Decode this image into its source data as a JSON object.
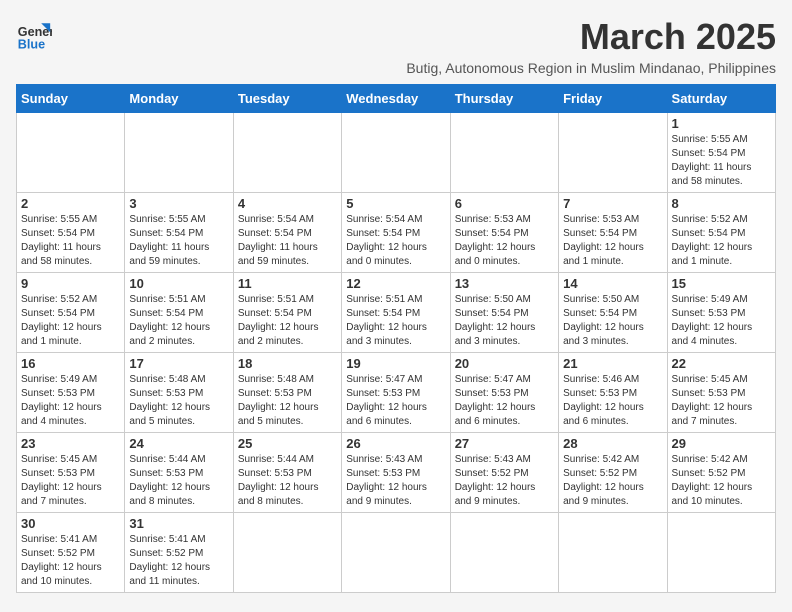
{
  "logo": {
    "text_general": "General",
    "text_blue": "Blue"
  },
  "header": {
    "month_year": "March 2025",
    "location": "Butig, Autonomous Region in Muslim Mindanao, Philippines"
  },
  "weekdays": [
    "Sunday",
    "Monday",
    "Tuesday",
    "Wednesday",
    "Thursday",
    "Friday",
    "Saturday"
  ],
  "days": [
    {
      "date": "",
      "info": ""
    },
    {
      "date": "",
      "info": ""
    },
    {
      "date": "",
      "info": ""
    },
    {
      "date": "",
      "info": ""
    },
    {
      "date": "",
      "info": ""
    },
    {
      "date": "",
      "info": ""
    },
    {
      "date": "1",
      "info": "Sunrise: 5:55 AM\nSunset: 5:54 PM\nDaylight: 11 hours\nand 58 minutes."
    },
    {
      "date": "2",
      "info": "Sunrise: 5:55 AM\nSunset: 5:54 PM\nDaylight: 11 hours\nand 58 minutes."
    },
    {
      "date": "3",
      "info": "Sunrise: 5:55 AM\nSunset: 5:54 PM\nDaylight: 11 hours\nand 59 minutes."
    },
    {
      "date": "4",
      "info": "Sunrise: 5:54 AM\nSunset: 5:54 PM\nDaylight: 11 hours\nand 59 minutes."
    },
    {
      "date": "5",
      "info": "Sunrise: 5:54 AM\nSunset: 5:54 PM\nDaylight: 12 hours\nand 0 minutes."
    },
    {
      "date": "6",
      "info": "Sunrise: 5:53 AM\nSunset: 5:54 PM\nDaylight: 12 hours\nand 0 minutes."
    },
    {
      "date": "7",
      "info": "Sunrise: 5:53 AM\nSunset: 5:54 PM\nDaylight: 12 hours\nand 1 minute."
    },
    {
      "date": "8",
      "info": "Sunrise: 5:52 AM\nSunset: 5:54 PM\nDaylight: 12 hours\nand 1 minute."
    },
    {
      "date": "9",
      "info": "Sunrise: 5:52 AM\nSunset: 5:54 PM\nDaylight: 12 hours\nand 1 minute."
    },
    {
      "date": "10",
      "info": "Sunrise: 5:51 AM\nSunset: 5:54 PM\nDaylight: 12 hours\nand 2 minutes."
    },
    {
      "date": "11",
      "info": "Sunrise: 5:51 AM\nSunset: 5:54 PM\nDaylight: 12 hours\nand 2 minutes."
    },
    {
      "date": "12",
      "info": "Sunrise: 5:51 AM\nSunset: 5:54 PM\nDaylight: 12 hours\nand 3 minutes."
    },
    {
      "date": "13",
      "info": "Sunrise: 5:50 AM\nSunset: 5:54 PM\nDaylight: 12 hours\nand 3 minutes."
    },
    {
      "date": "14",
      "info": "Sunrise: 5:50 AM\nSunset: 5:54 PM\nDaylight: 12 hours\nand 3 minutes."
    },
    {
      "date": "15",
      "info": "Sunrise: 5:49 AM\nSunset: 5:53 PM\nDaylight: 12 hours\nand 4 minutes."
    },
    {
      "date": "16",
      "info": "Sunrise: 5:49 AM\nSunset: 5:53 PM\nDaylight: 12 hours\nand 4 minutes."
    },
    {
      "date": "17",
      "info": "Sunrise: 5:48 AM\nSunset: 5:53 PM\nDaylight: 12 hours\nand 5 minutes."
    },
    {
      "date": "18",
      "info": "Sunrise: 5:48 AM\nSunset: 5:53 PM\nDaylight: 12 hours\nand 5 minutes."
    },
    {
      "date": "19",
      "info": "Sunrise: 5:47 AM\nSunset: 5:53 PM\nDaylight: 12 hours\nand 6 minutes."
    },
    {
      "date": "20",
      "info": "Sunrise: 5:47 AM\nSunset: 5:53 PM\nDaylight: 12 hours\nand 6 minutes."
    },
    {
      "date": "21",
      "info": "Sunrise: 5:46 AM\nSunset: 5:53 PM\nDaylight: 12 hours\nand 6 minutes."
    },
    {
      "date": "22",
      "info": "Sunrise: 5:45 AM\nSunset: 5:53 PM\nDaylight: 12 hours\nand 7 minutes."
    },
    {
      "date": "23",
      "info": "Sunrise: 5:45 AM\nSunset: 5:53 PM\nDaylight: 12 hours\nand 7 minutes."
    },
    {
      "date": "24",
      "info": "Sunrise: 5:44 AM\nSunset: 5:53 PM\nDaylight: 12 hours\nand 8 minutes."
    },
    {
      "date": "25",
      "info": "Sunrise: 5:44 AM\nSunset: 5:53 PM\nDaylight: 12 hours\nand 8 minutes."
    },
    {
      "date": "26",
      "info": "Sunrise: 5:43 AM\nSunset: 5:53 PM\nDaylight: 12 hours\nand 9 minutes."
    },
    {
      "date": "27",
      "info": "Sunrise: 5:43 AM\nSunset: 5:52 PM\nDaylight: 12 hours\nand 9 minutes."
    },
    {
      "date": "28",
      "info": "Sunrise: 5:42 AM\nSunset: 5:52 PM\nDaylight: 12 hours\nand 9 minutes."
    },
    {
      "date": "29",
      "info": "Sunrise: 5:42 AM\nSunset: 5:52 PM\nDaylight: 12 hours\nand 10 minutes."
    },
    {
      "date": "30",
      "info": "Sunrise: 5:41 AM\nSunset: 5:52 PM\nDaylight: 12 hours\nand 10 minutes."
    },
    {
      "date": "31",
      "info": "Sunrise: 5:41 AM\nSunset: 5:52 PM\nDaylight: 12 hours\nand 11 minutes."
    },
    {
      "date": "",
      "info": ""
    },
    {
      "date": "",
      "info": ""
    },
    {
      "date": "",
      "info": ""
    },
    {
      "date": "",
      "info": ""
    },
    {
      "date": "",
      "info": ""
    }
  ]
}
